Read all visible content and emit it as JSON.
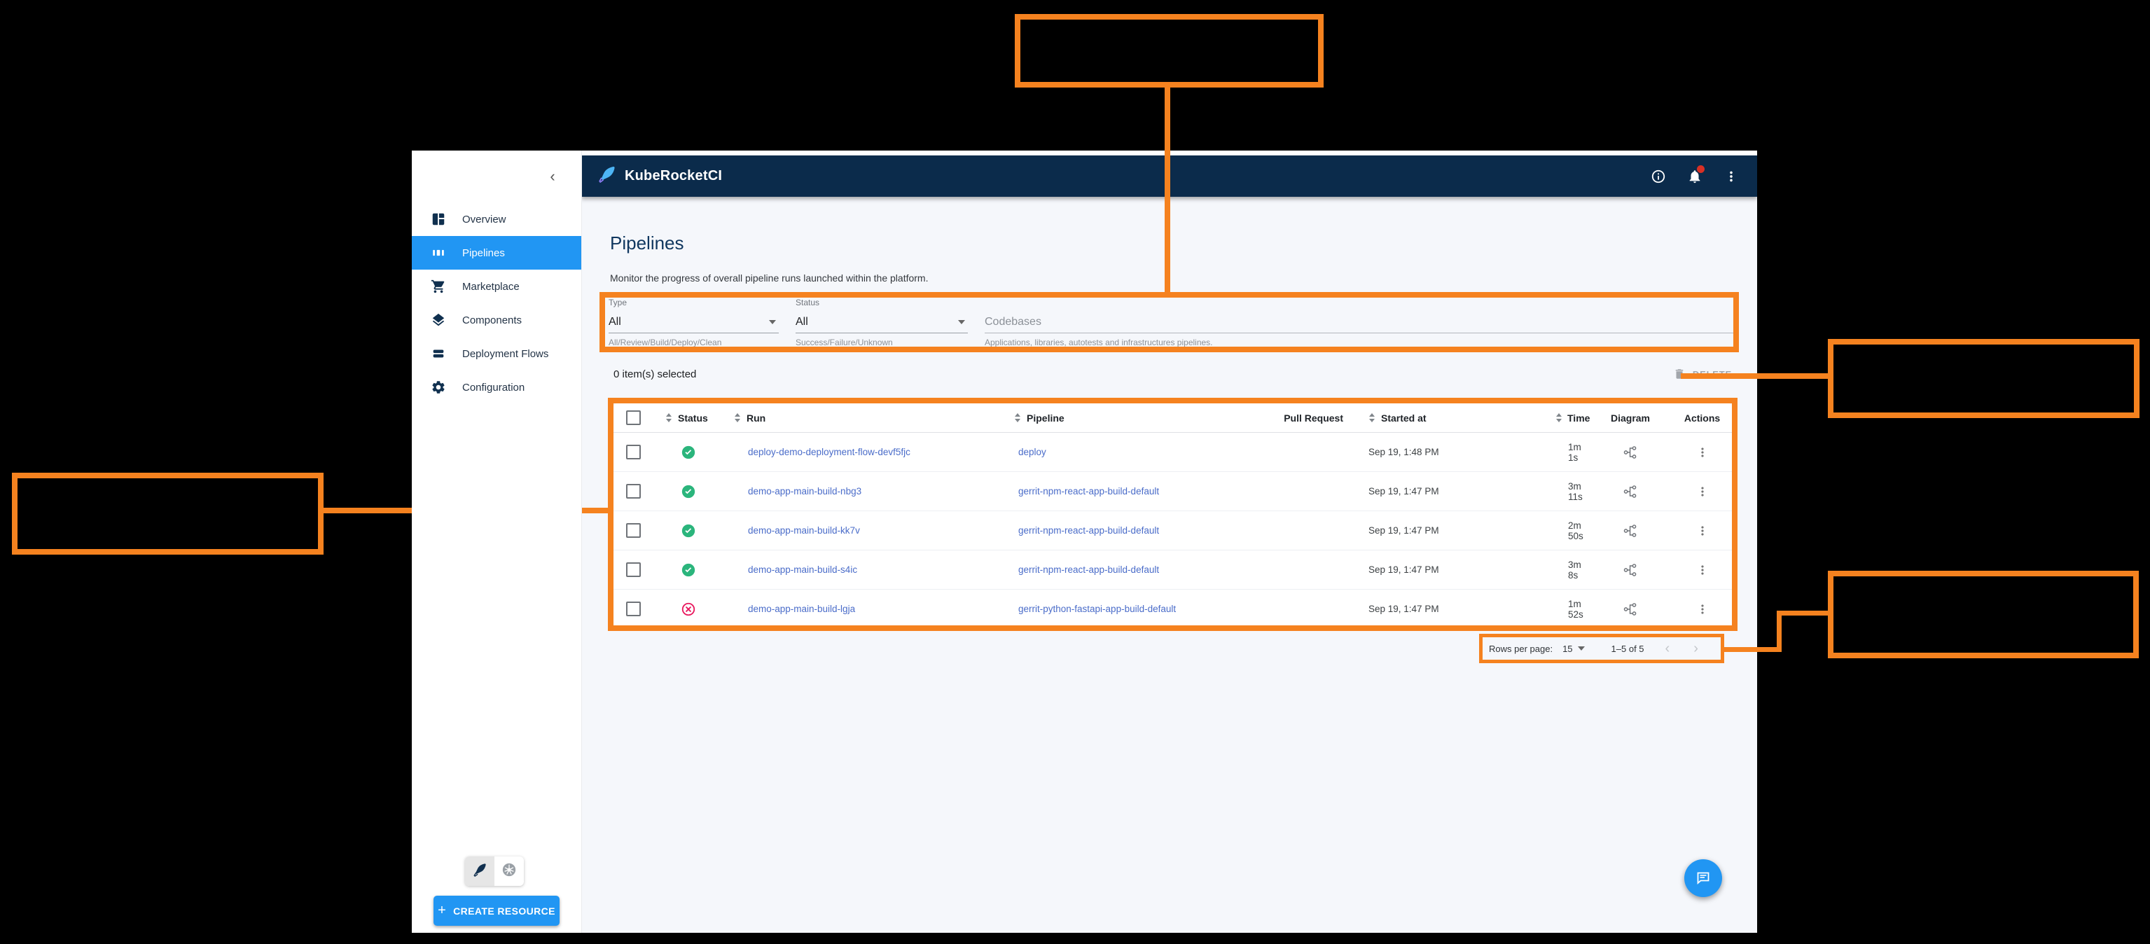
{
  "app": {
    "brand": "KubeRocketCI"
  },
  "header": {
    "icons": [
      "info-icon",
      "notifications-icon",
      "kebab-icon"
    ],
    "notification_badge": true
  },
  "sidebar": {
    "collapse_icon": "chevron-left-icon",
    "items": [
      {
        "label": "Overview",
        "icon": "overview",
        "selected": false
      },
      {
        "label": "Pipelines",
        "icon": "pipelines",
        "selected": true
      },
      {
        "label": "Marketplace",
        "icon": "marketplace",
        "selected": false
      },
      {
        "label": "Components",
        "icon": "components",
        "selected": false
      },
      {
        "label": "Deployment Flows",
        "icon": "deployment-flows",
        "selected": false
      },
      {
        "label": "Configuration",
        "icon": "configuration",
        "selected": false
      }
    ],
    "bottom_toggle": [
      "quill-icon",
      "kubernetes-icon"
    ],
    "create_button": "CREATE RESOURCE"
  },
  "page": {
    "title": "Pipelines",
    "subtitle": "Monitor the progress of overall pipeline runs launched within the platform."
  },
  "filters": {
    "type": {
      "label": "Type",
      "value": "All",
      "helper": "All/Review/Build/Deploy/Clean"
    },
    "status": {
      "label": "Status",
      "value": "All",
      "helper": "Success/Failure/Unknown"
    },
    "codebases": {
      "placeholder": "Codebases",
      "helper": "Applications, libraries, autotests and infrastructures pipelines."
    }
  },
  "selection": {
    "text": "0 item(s) selected",
    "delete_label": "DELETE"
  },
  "table": {
    "columns": [
      "Status",
      "Run",
      "Pipeline",
      "Pull Request",
      "Started at",
      "Time",
      "Diagram",
      "Actions"
    ],
    "rows": [
      {
        "status": "success",
        "run": "deploy-demo-deployment-flow-devf5fjc",
        "pipeline": "deploy",
        "pull_request": "",
        "started_at": "Sep 19, 1:48 PM",
        "time": "1m 1s"
      },
      {
        "status": "success",
        "run": "demo-app-main-build-nbg3",
        "pipeline": "gerrit-npm-react-app-build-default",
        "pull_request": "",
        "started_at": "Sep 19, 1:47 PM",
        "time": "3m 11s"
      },
      {
        "status": "success",
        "run": "demo-app-main-build-kk7v",
        "pipeline": "gerrit-npm-react-app-build-default",
        "pull_request": "",
        "started_at": "Sep 19, 1:47 PM",
        "time": "2m 50s"
      },
      {
        "status": "success",
        "run": "demo-app-main-build-s4ic",
        "pipeline": "gerrit-npm-react-app-build-default",
        "pull_request": "",
        "started_at": "Sep 19, 1:47 PM",
        "time": "3m 8s"
      },
      {
        "status": "failure",
        "run": "demo-app-main-build-lgja",
        "pipeline": "gerrit-python-fastapi-app-build-default",
        "pull_request": "",
        "started_at": "Sep 19, 1:47 PM",
        "time": "1m 52s"
      }
    ]
  },
  "pagination": {
    "rows_per_page_label": "Rows per page:",
    "rows_per_page": "15",
    "range": "1–5 of 5",
    "prev_icon": "chevron-left-icon",
    "next_icon": "chevron-right-icon"
  },
  "colors": {
    "annotation_orange": "#f5821f",
    "header_navy": "#0b2b4b",
    "accent_blue": "#2196f3",
    "link_blue": "#4a6cc9",
    "success_green": "#2bb57c",
    "failure_red": "#e8185d"
  }
}
